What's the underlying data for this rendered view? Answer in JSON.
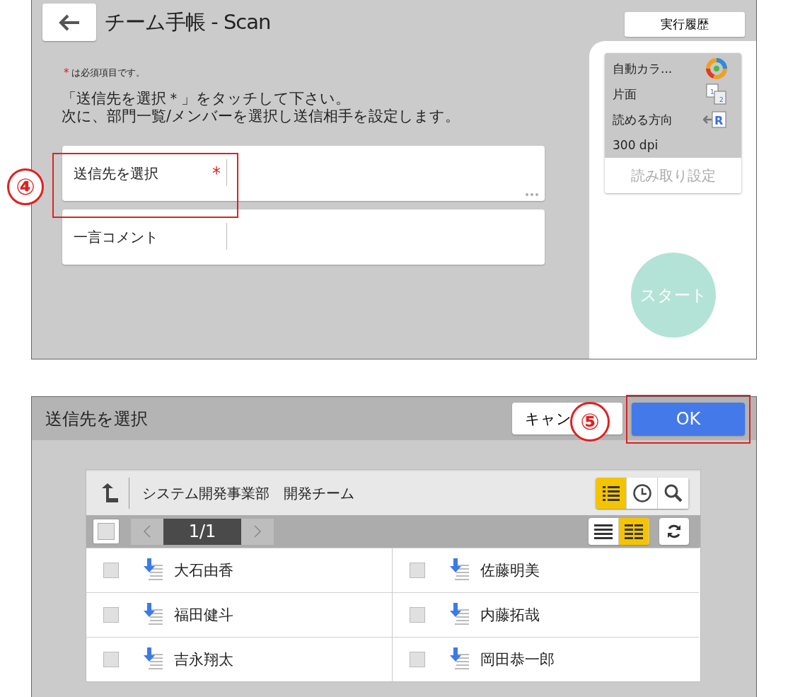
{
  "scan_screen": {
    "title": "チーム手帳 - Scan",
    "history_button": "実行履歴",
    "required_note": {
      "mark": "*",
      "text": "は必須項目です。"
    },
    "instructions": [
      "「送信先を選択＊」をタッチして下さい。",
      "次に、部門一覧/メンバーを選択し送信相手を設定します。"
    ],
    "fields": [
      {
        "label": "送信先を選択",
        "required_mark": "*",
        "more": true
      },
      {
        "label": "一言コメント",
        "more": false
      }
    ],
    "scan_settings": {
      "items": [
        {
          "label": "自動カラ...",
          "kind": "color"
        },
        {
          "label": "片面",
          "kind": "simplex",
          "icon_labels": [
            "1",
            "2"
          ]
        },
        {
          "label": "読める方向",
          "kind": "orientation",
          "icon_labels": [
            "R"
          ]
        },
        {
          "label": "300 dpi",
          "kind": "text"
        }
      ],
      "button": "読み取り設定",
      "button_disabled": true
    },
    "start_button": {
      "label": "スタート",
      "disabled": true
    },
    "callout": "④"
  },
  "dialog": {
    "title": "送信先を選択",
    "cancel_button": "キャン",
    "ok_button": "OK",
    "callout": "⑤",
    "breadcrumb": "システム開発事業部　開発チーム",
    "view_tabs": [
      {
        "kind": "list",
        "selected": true
      },
      {
        "kind": "history",
        "selected": false
      },
      {
        "kind": "search",
        "selected": false
      }
    ],
    "select_all": {
      "checked": false
    },
    "pager": {
      "page": "1/1"
    },
    "layout_tabs": [
      {
        "kind": "single",
        "selected": false
      },
      {
        "kind": "double",
        "selected": true
      }
    ],
    "members": [
      {
        "name": "大石由香",
        "checked": false
      },
      {
        "name": "佐藤明美",
        "checked": false
      },
      {
        "name": "福田健斗",
        "checked": false
      },
      {
        "name": "内藤拓哉",
        "checked": false
      },
      {
        "name": "吉永翔太",
        "checked": false
      },
      {
        "name": "岡田恭一郎",
        "checked": false
      }
    ]
  }
}
